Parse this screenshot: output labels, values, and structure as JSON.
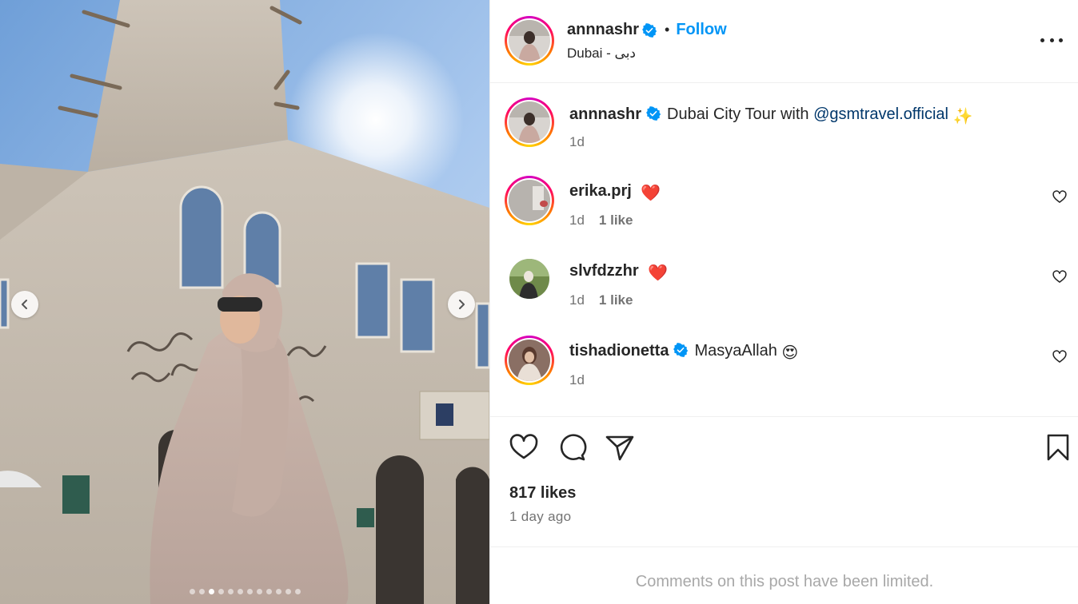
{
  "post": {
    "author": "annnashr",
    "follow_label": "Follow",
    "separator": "•",
    "location": "Dubai - دبی",
    "carousel": {
      "total_slides": 12,
      "active_index": 2
    }
  },
  "caption": {
    "username": "annnashr",
    "text_prefix": "Dubai City Tour with",
    "mention": "@gsmtravel.official",
    "emoji": "✨",
    "time": "1d"
  },
  "comments": [
    {
      "username": "erika.prj",
      "text": "",
      "emoji": "❤️",
      "time": "1d",
      "likes": "1 like",
      "verified": false
    },
    {
      "username": "slvfdzzhr",
      "text": "",
      "emoji": "❤️",
      "time": "1d",
      "likes": "1 like",
      "verified": false
    },
    {
      "username": "tishadionetta",
      "text": "MasyaAllah",
      "emoji": "😍",
      "time": "1d",
      "likes": "",
      "verified": true
    }
  ],
  "footer": {
    "likes": "817 likes",
    "time_ago": "1 day ago",
    "limited_notice": "Comments on this post have been limited."
  },
  "colors": {
    "accent": "#0095f6",
    "verified": "#0095f6",
    "text": "#262626",
    "muted": "#737373",
    "mention": "#00376b",
    "heart": "#ff3040"
  }
}
